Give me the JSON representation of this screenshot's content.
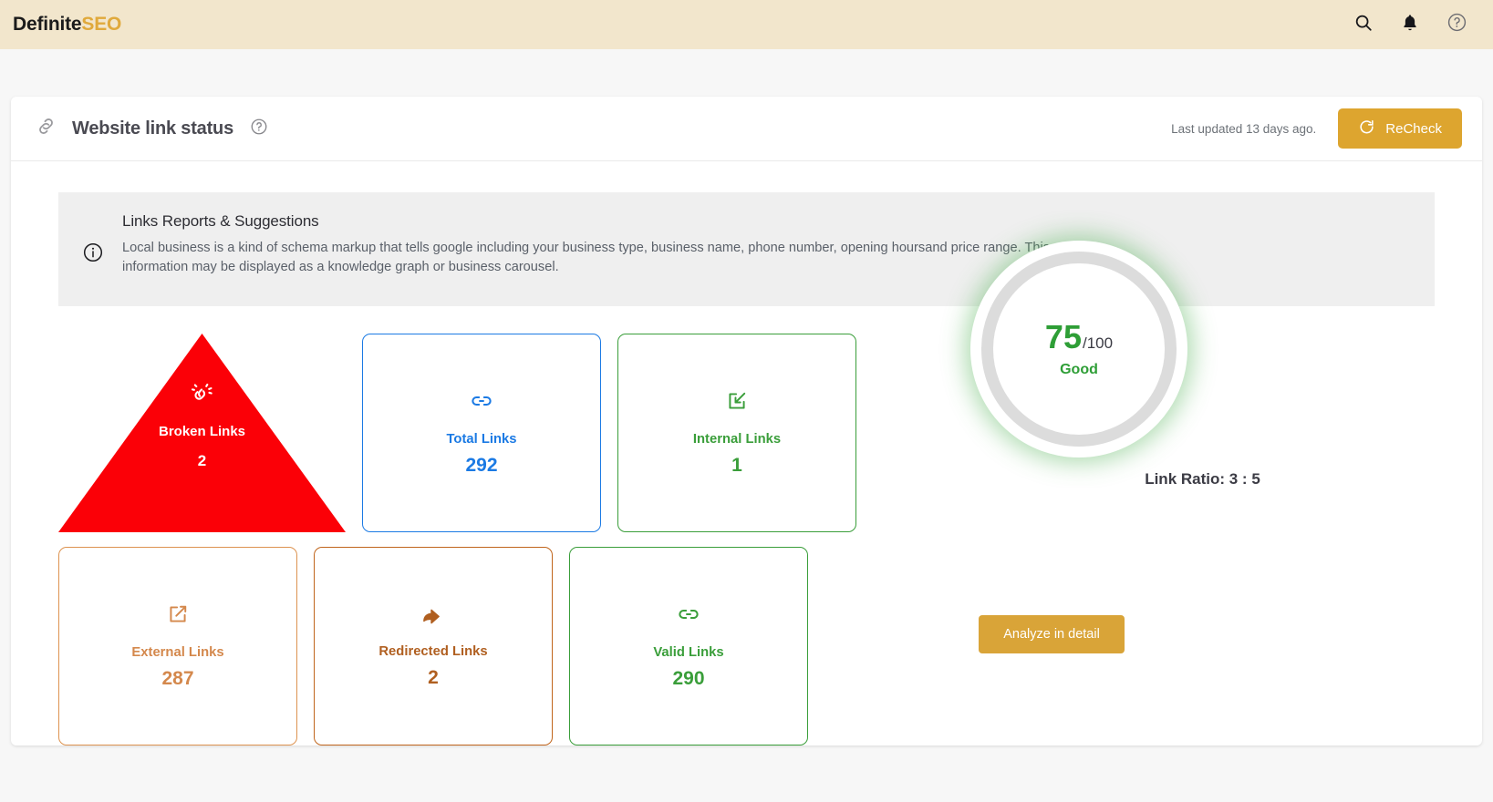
{
  "topbar": {
    "logo_primary": "Definite",
    "logo_accent": "SEO",
    "icons": [
      {
        "name": "search-icon",
        "label": "Search"
      },
      {
        "name": "bell-icon",
        "label": "Notifications"
      },
      {
        "name": "help-circle-icon",
        "label": "Help"
      }
    ]
  },
  "card": {
    "title": "Website link status",
    "last_updated": "Last updated 13 days ago.",
    "recheck_label": "ReCheck",
    "link_icon": "chain-link-icon",
    "help_icon": "help-circle-icon",
    "refresh_icon": "refresh-icon"
  },
  "info": {
    "icon": "info-circle-icon",
    "title": "Links Reports & Suggestions",
    "text": "Local business is a kind of schema markup that tells google including your business type, business name, phone number, opening hoursand price range. This information may be displayed as a knowledge graph or business carousel."
  },
  "metrics": {
    "broken": {
      "label": "Broken Links",
      "value": "2",
      "icon": "broken-link-icon",
      "color": "#fb0007"
    },
    "total": {
      "label": "Total Links",
      "value": "292",
      "icon": "link-icon",
      "color": "#1b7ae4"
    },
    "internal": {
      "label": "Internal Links",
      "value": "1",
      "icon": "arrow-into-box-icon",
      "color": "#3a9e3a"
    },
    "external": {
      "label": "External Links",
      "value": "287",
      "icon": "external-link-icon",
      "color": "#d4884c"
    },
    "redirected": {
      "label": "Redirected Links",
      "value": "2",
      "icon": "redirect-arrow-icon",
      "color": "#b05f20"
    },
    "valid": {
      "label": "Valid Links",
      "value": "290",
      "icon": "link-icon",
      "color": "#3a9e3a"
    }
  },
  "score": {
    "value": "75",
    "max": "/100",
    "grade": "Good",
    "grade_color": "#2e9e36",
    "ratio": "Link Ratio: 3 : 5",
    "analyze_label": "Analyze in detail"
  }
}
